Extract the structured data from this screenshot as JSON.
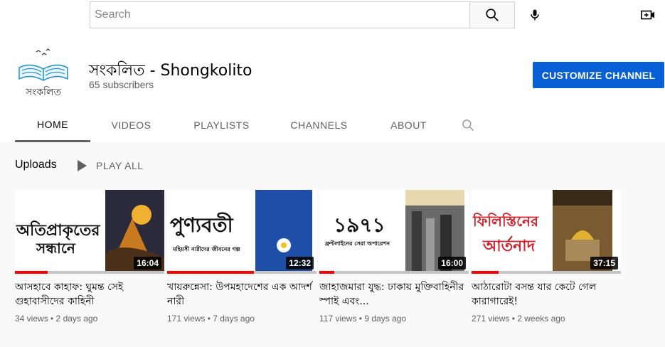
{
  "search": {
    "placeholder": "Search"
  },
  "topbar": {
    "icons": [
      "search-icon",
      "mic-icon",
      "create-video-icon"
    ]
  },
  "channel": {
    "name": "সংকলিত - Shongkolito",
    "subscribers": "65 subscribers",
    "avatar_text": "সংকলিত",
    "customize_label": "CUSTOMIZE CHANNEL"
  },
  "tabs": [
    {
      "label": "HOME",
      "active": true
    },
    {
      "label": "VIDEOS"
    },
    {
      "label": "PLAYLISTS"
    },
    {
      "label": "CHANNELS"
    },
    {
      "label": "ABOUT"
    }
  ],
  "uploads": {
    "title": "Uploads",
    "play_all": "PLAY ALL",
    "videos": [
      {
        "thumb_text_1": "অতিপ্রাকৃতের",
        "thumb_text_2": "সন্ধানে",
        "duration": "16:04",
        "progress": 0.22,
        "title": "আসহাবে কাহাফ: ঘুমন্ত সেই গুহাবাসীদের কাহিনী",
        "meta": "34 views • 2 days ago"
      },
      {
        "thumb_text_1": "পুণ্যবতী",
        "thumb_text_2": "মহিয়সী নারীদের জীবনের গল্প",
        "duration": "12:32",
        "progress": 0.58,
        "title": "খায়রুন্নেসা: উপমহাদেশের এক আদর্শ নারী",
        "meta": "171 views • 7 days ago"
      },
      {
        "thumb_text_1": "১৯৭১",
        "thumb_text_2": "ফ্রন্টলাইনের সেরা অপারেশন",
        "duration": "16:00",
        "progress": 0.1,
        "title": "জাহাজমারা যুদ্ধ: ঢাকায় মুক্তিবাহিনীর স্পাই এবং...",
        "meta": "117 views • 9 days ago"
      },
      {
        "thumb_text_1": "ফিলিস্তিনের",
        "thumb_text_2": "আর্তনাদ",
        "duration": "37:15",
        "progress": 0.18,
        "title": "আঠারোটা বসন্ত যার কেটে গেল কারাগারেই!",
        "meta": "271 views • 2 weeks ago"
      }
    ]
  },
  "colors": {
    "accent": "#065fd4",
    "progress": "#ff0000",
    "text_secondary": "#606060"
  }
}
